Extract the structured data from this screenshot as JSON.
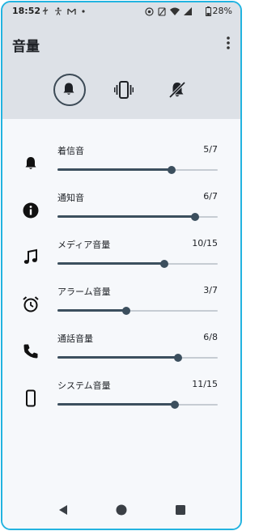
{
  "status": {
    "time": "18:52",
    "battery": "28%",
    "left_icons": [
      "usb-icon",
      "accessibility-icon",
      "gmail-icon",
      "dot-icon"
    ],
    "right_icons": [
      "focus-icon",
      "alarm-off-icon",
      "wifi-icon",
      "signal-icon",
      "battery-icon"
    ]
  },
  "header": {
    "title": "音量",
    "more_icon": "more-vert-icon",
    "modes": [
      {
        "icon": "bell-icon",
        "selected": true
      },
      {
        "icon": "vibrate-icon",
        "selected": false
      },
      {
        "icon": "bell-off-icon",
        "selected": false
      }
    ]
  },
  "volumes": [
    {
      "label": "着信音",
      "value_text": "5/7",
      "value": 5,
      "max": 7,
      "icon": "bell-icon"
    },
    {
      "label": "通知音",
      "value_text": "6/7",
      "value": 6,
      "max": 7,
      "icon": "info-icon"
    },
    {
      "label": "メディア音量",
      "value_text": "10/15",
      "value": 10,
      "max": 15,
      "icon": "music-note-icon"
    },
    {
      "label": "アラーム音量",
      "value_text": "3/7",
      "value": 3,
      "max": 7,
      "icon": "alarm-icon"
    },
    {
      "label": "通話音量",
      "value_text": "6/8",
      "value": 6,
      "max": 8,
      "icon": "phone-icon"
    },
    {
      "label": "システム音量",
      "value_text": "11/15",
      "value": 11,
      "max": 15,
      "icon": "phone-device-icon"
    }
  ],
  "nav": [
    "back-icon",
    "home-icon",
    "recents-icon"
  ],
  "colors": {
    "accent": "#3c4f5e",
    "header_bg": "#dde1e7",
    "frame": "#22b3e0"
  }
}
